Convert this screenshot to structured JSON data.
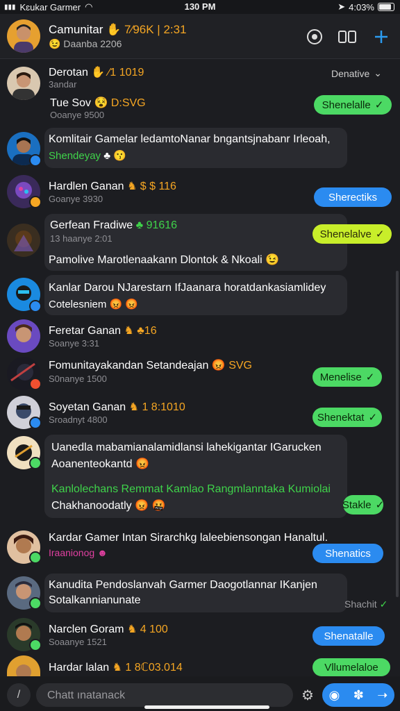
{
  "status": {
    "carrier": "Kɛukar Garmer",
    "time": "130 PM",
    "battery": "4:03%"
  },
  "header": {
    "title": "Camunitar",
    "title_tag": "✋ 7⁄96K | 2:31",
    "subtitle": "Daanba 2206",
    "subtitle_emoji": "😉"
  },
  "filter": {
    "label": "Denative",
    "icon": "chevron-down-icon"
  },
  "messages": [
    {
      "name": "Derotan",
      "tag": "✋ ⁄1 1019",
      "meta": "3andar",
      "line2_name": "Tue Sov",
      "line2_tag": "😵 D:SVG",
      "line2_meta": "Ooanye 9500"
    },
    {
      "text": "Komlitair Gamelar ledamtoNanar bngantsjnabanr Irleoah,",
      "line2": "Shendeyay",
      "line2_emoji": "♣ 😗"
    },
    {
      "name": "Hardlen Ganan",
      "tag": "♞ $ $ 116",
      "meta": "Goanye 3930"
    },
    {
      "name": "Gerfean Fradiwe",
      "tag": "♣ 91616",
      "meta": "13 haanye 2:01",
      "text": "Pamolive Marotlenaakann Dlontok & Nkoali 😉"
    },
    {
      "text": "Kanlar Darou NJarestarn IfJaanara horatdankasiamlidey",
      "line2": "Cotelesniem",
      "line2_emoji": "😡 😡"
    },
    {
      "name": "Feretar Ganan",
      "tag": "♞ ♣16",
      "meta": "Soanye 3:31"
    },
    {
      "name": "Fomunitayakandan Setandeajan",
      "tag": "😡 SVG",
      "meta": "S0nanye 1500"
    },
    {
      "name": "Soyetan Ganan",
      "tag": "♞ 1 8:1010",
      "meta": "Sroadnyt 4800"
    },
    {
      "text": "Uanedla mabamianalamidlansi lahekigantar IGarucken",
      "line2": "Aoanenteokantd",
      "line2_emoji": "😡",
      "green_line": "Kanlolechans Remmat Kamlao Rangmlanntaka Kumiolai",
      "green_line2": "Chakhanoodatly",
      "green_emoji": "😡 🤬"
    },
    {
      "name": "Kardar Gamer Intan Sirarchkg laleebiensongan Hanaltul.",
      "line2": "Iraanionog",
      "line2_emoji": "☻"
    },
    {
      "text": "Kanudita Pendoslanvah Garmer Daogotlannar IKanjen",
      "line2": "Sotalkannianunate"
    },
    {
      "name": "Narclen Goram",
      "tag": "♞ 4 100",
      "meta": "Soaanye 1521"
    },
    {
      "name": "Hardar lalan",
      "tag": "♞ 1 8ℂ03.014"
    }
  ],
  "pills": {
    "p1": "Shenelalle",
    "p2": "Sherectiks",
    "p3": "Shenelalve",
    "p4": "Menelise",
    "p5": "Shenektat",
    "p6": "Stakle",
    "p7": "Shenatics",
    "p8": "Shachit",
    "p9": "Shenatalle",
    "p10": "Vllumelaloe"
  },
  "composer": {
    "placeholder": "Chatt ınatanack"
  },
  "colors": {
    "green": "#4cd964",
    "lime": "#c8ee2a",
    "blue": "#2b8bf0",
    "orange": "#f5a623"
  }
}
